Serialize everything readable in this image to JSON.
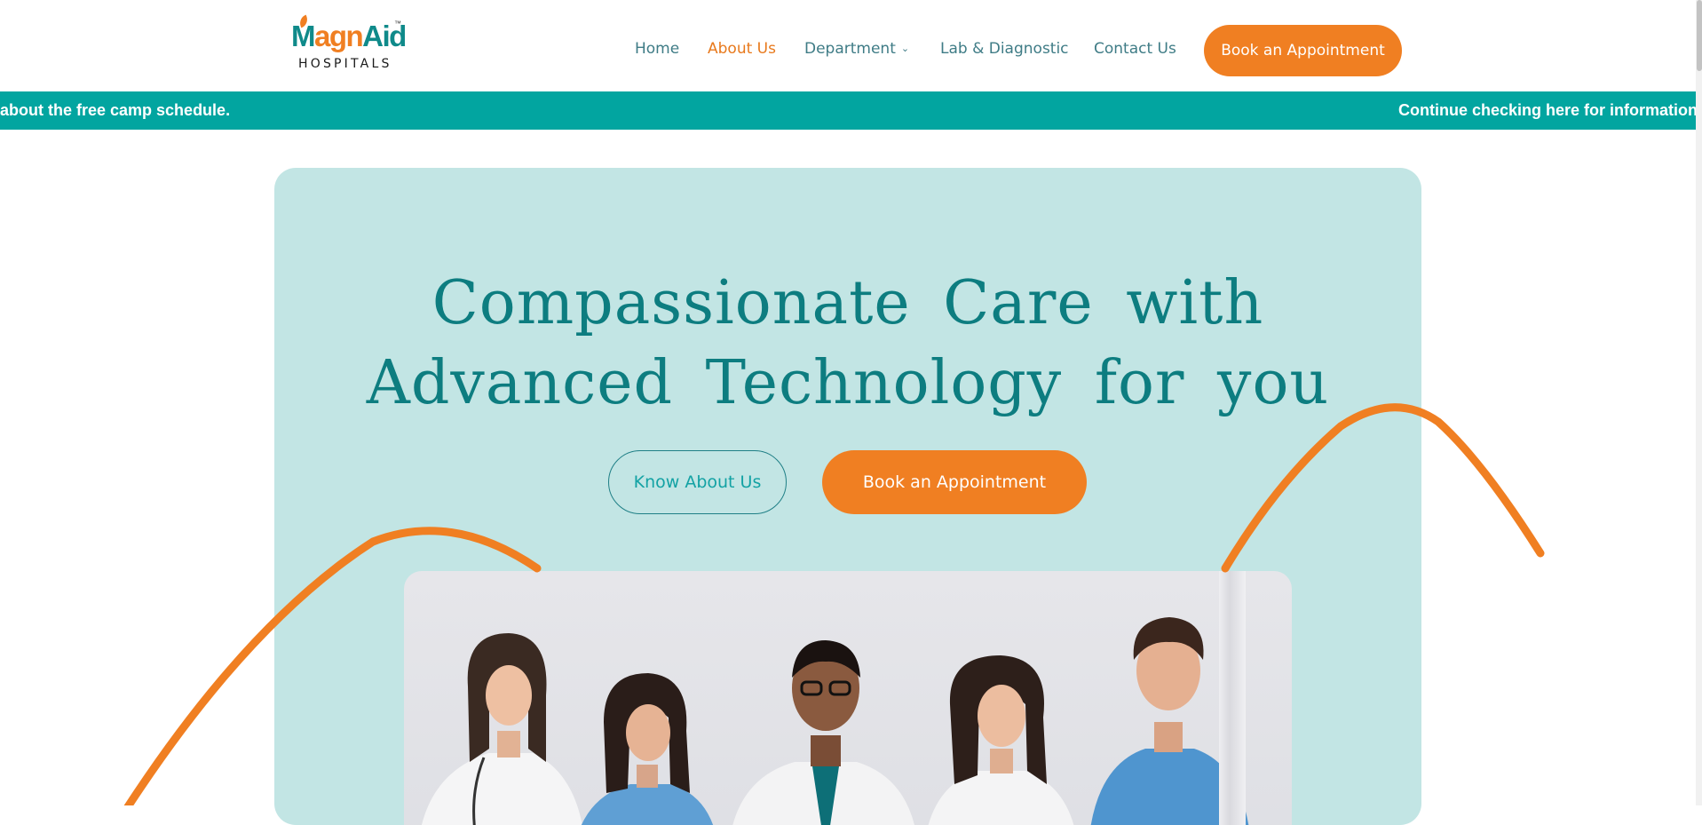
{
  "header": {
    "logo": {
      "brand_part1": "M",
      "brand_part2": "agn",
      "brand_part3": "Aid",
      "trademark": "™",
      "sub": "HOSPITALS"
    },
    "nav": [
      {
        "label": "Home",
        "active": false
      },
      {
        "label": "About Us",
        "active": true
      },
      {
        "label": "Department",
        "active": false,
        "has_dropdown": true
      },
      {
        "label": "Lab & Diagnostic",
        "active": false
      },
      {
        "label": "Contact Us",
        "active": false
      }
    ],
    "cta_label": "Book an Appointment"
  },
  "ticker": {
    "text_left": "about the free camp schedule.",
    "text_right": "Continue checking here for information"
  },
  "hero": {
    "title_line1": "Compassionate Care with",
    "title_line2": "Advanced Technology for you",
    "secondary_button": "Know About Us",
    "primary_button": "Book an Appointment",
    "image_alt": "team-of-doctors-photo"
  },
  "colors": {
    "brand_teal": "#0d7d80",
    "accent_orange": "#f07f22",
    "ticker_bg": "#02a5a0",
    "hero_bg": "#c2e5e4"
  }
}
